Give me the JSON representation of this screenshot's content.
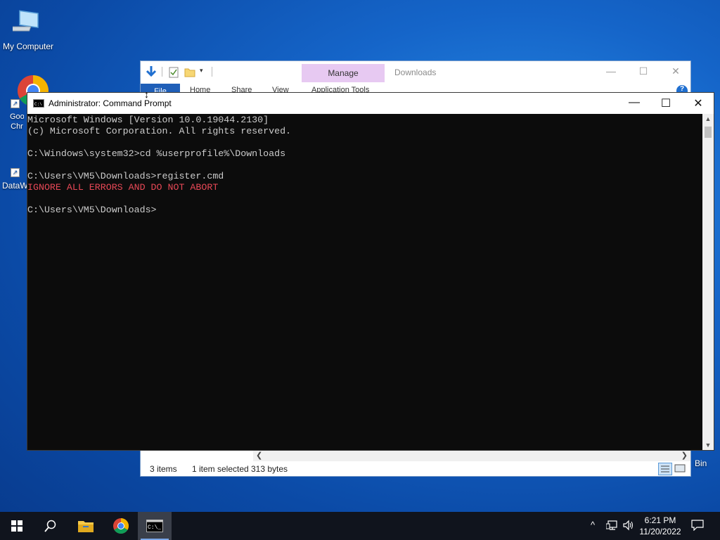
{
  "desktop": {
    "icons": [
      {
        "label": "My Computer",
        "icon": "computer-icon"
      },
      {
        "label": "Goo Chr",
        "icon": "chrome-icon"
      },
      {
        "label": "DataW",
        "icon": "datawrapper-icon"
      },
      {
        "label": "Bin",
        "icon": "recycle-bin-icon"
      }
    ]
  },
  "explorer": {
    "title": "Downloads",
    "manage_tab": "Manage",
    "context_tab": "Application Tools",
    "tabs": [
      "File",
      "Home",
      "Share",
      "View"
    ],
    "status": {
      "items": "3 items",
      "selected": "1 item selected",
      "size": "313 bytes"
    }
  },
  "cmd": {
    "title": "Administrator: Command Prompt",
    "lines": {
      "l1": "Microsoft Windows [Version 10.0.19044.2130]",
      "l2": "(c) Microsoft Corporation. All rights reserved.",
      "l3": "",
      "l4": "C:\\Windows\\system32>cd %userprofile%\\Downloads",
      "l5": "",
      "l6": "C:\\Users\\VM5\\Downloads>register.cmd",
      "l7": "IGNORE ALL ERRORS AND DO NOT ABORT",
      "l8": "",
      "l9": "C:\\Users\\VM5\\Downloads>"
    },
    "error_color": "#e74856"
  },
  "taskbar": {
    "clock_time": "6:21 PM",
    "clock_date": "11/20/2022",
    "accent": "#7aa7e8"
  }
}
